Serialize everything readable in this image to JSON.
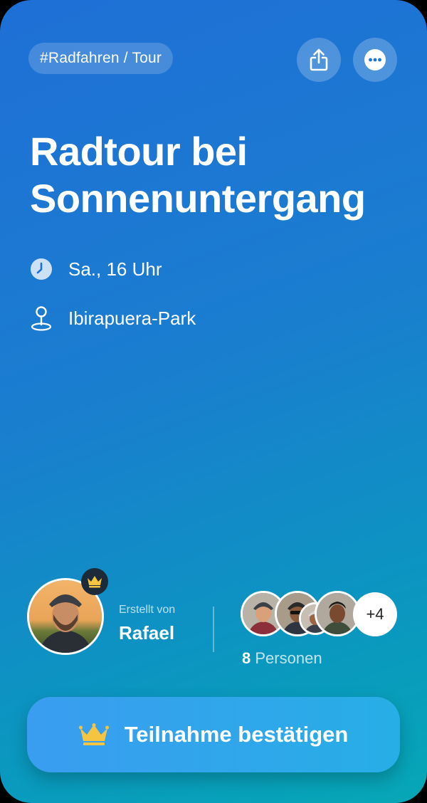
{
  "event": {
    "tag": "#Radfahren / Tour",
    "title_line1": "Radtour bei",
    "title_line2": "Sonnenuntergang",
    "time": "Sa., 16 Uhr",
    "location": "Ibirapuera-Park"
  },
  "creator": {
    "label": "Erstellt von",
    "name": "Rafael"
  },
  "participants": {
    "more": "+4",
    "count": "8",
    "count_label": "Personen"
  },
  "cta": {
    "label": "Teilnahme bestätigen"
  },
  "icons": {
    "share": "share-icon",
    "more": "more-icon",
    "clock": "clock-icon",
    "pin": "map-pin-icon",
    "crown": "crown-icon"
  },
  "colors": {
    "gradient_start": "#1f6fd6",
    "gradient_end": "#06a7b6",
    "crown": "#f5c542"
  }
}
